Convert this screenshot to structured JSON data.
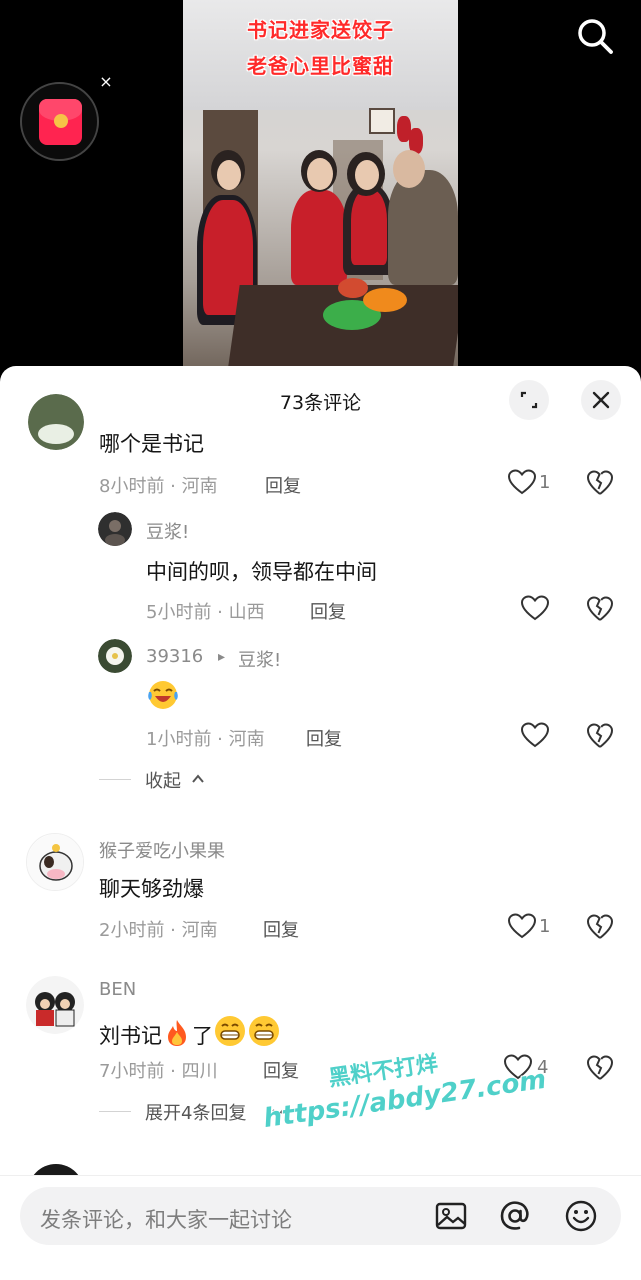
{
  "video": {
    "caption_line1": "书记进家送饺子",
    "caption_line2": "老爸心里比蜜甜",
    "search_icon": "search-icon",
    "red_packet_icon": "red-envelope-icon",
    "red_packet_close": "×"
  },
  "sheet": {
    "title": "73条评论",
    "expand_icon": "expand-icon",
    "close_icon": "close-icon"
  },
  "comments": {
    "c1": {
      "text": "哪个是书记",
      "meta": "8小时前 · 河南",
      "reply_label": "回复",
      "likes": "1"
    },
    "r1": {
      "user": "豆浆!",
      "text": "中间的呗，领导都在中间",
      "meta": "5小时前 · 山西",
      "reply_label": "回复"
    },
    "r2": {
      "user": "39316",
      "arrow": "▸",
      "reply_to": "豆浆!",
      "emoji": "laughing-tears-emoji",
      "meta": "1小时前 · 河南",
      "reply_label": "回复"
    },
    "collapse_label": "收起",
    "c2": {
      "user": "猴子爱吃小果果",
      "text": "聊天够劲爆",
      "meta": "2小时前 · 河南",
      "reply_label": "回复",
      "likes": "1"
    },
    "c3": {
      "user": "BEN",
      "text_a": "刘书记",
      "text_b": "了",
      "meta": "7小时前 · 四川",
      "reply_label": "回复",
      "likes": "4",
      "expand_label": "展开4条回复"
    }
  },
  "input": {
    "placeholder": "发条评论，和大家一起讨论",
    "image_icon": "image-icon",
    "mention_icon": "at-mention-icon",
    "emoji_icon": "emoji-icon"
  },
  "watermark": {
    "line1": "黑料不打烊",
    "line2": "https://abdy27.com"
  },
  "colors": {
    "caption_red": "#ff2a2a",
    "red_packet": "#ff2450",
    "watermark": "#4fd0c9"
  }
}
